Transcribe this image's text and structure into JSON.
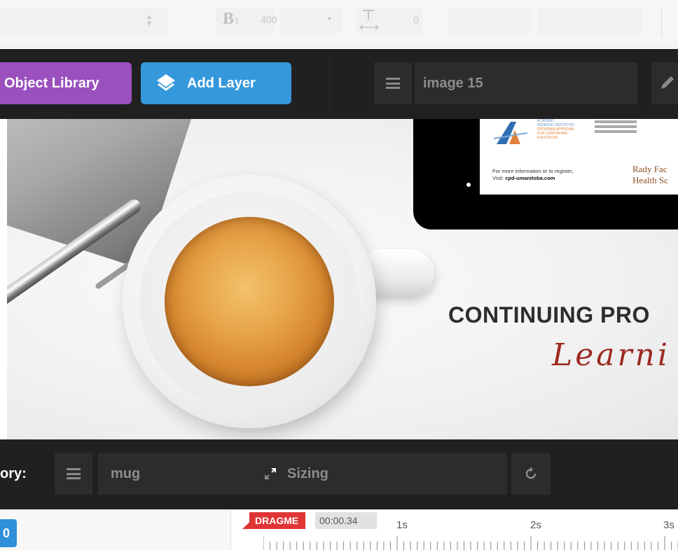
{
  "top_bar": {
    "font_weight": "400",
    "letter_spacing": "0"
  },
  "toolbar": {
    "object_library_label": "Object Library",
    "add_layer_label": "Add Layer",
    "layer_name": "image 15"
  },
  "canvas": {
    "tablet_screen": {
      "academy_line1": "ACADEMY",
      "academy_line2": "GENERAL DENTISTRY",
      "academy_line3": "PROGRAM APPROVAL",
      "academy_line4": "FOR CONTINUING",
      "academy_line5": "EDUCATION",
      "more_info_line1": "For more information or to register,",
      "more_info_line2_prefix": "Visit: ",
      "more_info_url": "cpd-umanitoba.com",
      "rady_line1": "Rady Fac",
      "rady_line2": "Health Sc"
    },
    "headline": "CONTINUING PRO",
    "script_text": "Learni"
  },
  "layer_bar": {
    "story_label": "ory:",
    "layer_name": "mug",
    "sizing_label": "Sizing"
  },
  "timeline": {
    "dragme_label": "DRAGME",
    "current_time": "00:00.34",
    "tick_labels": [
      "1s",
      "2s",
      "3s"
    ],
    "left_button_glyph": "0"
  },
  "colors": {
    "object_library": "#9a50bd",
    "add_layer": "#3498db",
    "toolbar_bg": "#202020",
    "dragme": "#e03535",
    "script_text": "#9b2a21"
  }
}
